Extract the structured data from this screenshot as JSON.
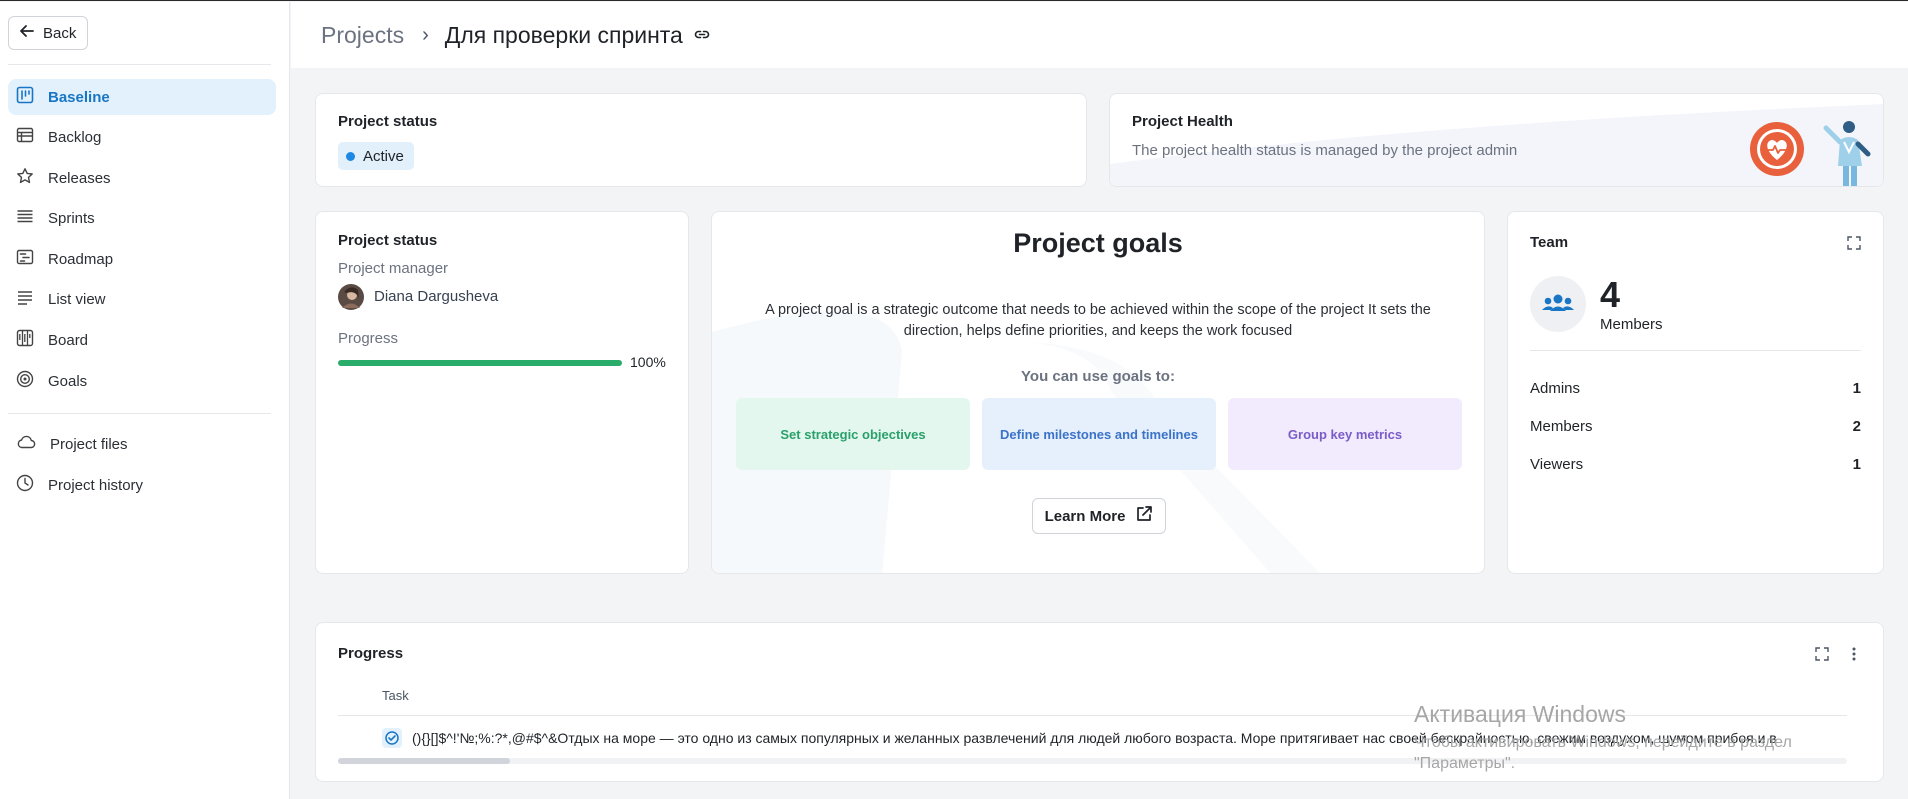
{
  "sidebar": {
    "back_label": "Back",
    "items": [
      {
        "label": "Baseline",
        "icon": "kanban-icon",
        "active": true
      },
      {
        "label": "Backlog",
        "icon": "table-icon"
      },
      {
        "label": "Releases",
        "icon": "star-icon"
      },
      {
        "label": "Sprints",
        "icon": "lines-icon"
      },
      {
        "label": "Roadmap",
        "icon": "roadmap-icon"
      },
      {
        "label": "List view",
        "icon": "list-icon"
      },
      {
        "label": "Board",
        "icon": "board-icon"
      },
      {
        "label": "Goals",
        "icon": "target-icon"
      }
    ],
    "secondary": [
      {
        "label": "Project files",
        "icon": "cloud-icon"
      },
      {
        "label": "Project history",
        "icon": "clock-icon"
      }
    ]
  },
  "header": {
    "projects": "Projects",
    "separator": "›",
    "project_name": "Для проверки спринта"
  },
  "status_card": {
    "title": "Project status",
    "status": "Active"
  },
  "health_card": {
    "title": "Project Health",
    "description": "The project health status is managed by the project admin"
  },
  "details_card": {
    "title": "Project status",
    "manager_label": "Project manager",
    "manager_name": "Diana Dargusheva",
    "progress_label": "Progress",
    "progress_text": "100%",
    "progress_value": 1.0
  },
  "goals_card": {
    "title": "Project goals",
    "description": "A project goal is a strategic outcome that needs to be achieved within the scope of the project It sets the direction, helps define priorities, and keeps the work focused",
    "use_label": "You can use goals to:",
    "boxes": [
      {
        "label": "Set strategic objectives"
      },
      {
        "label": "Define milestones and timelines"
      },
      {
        "label": "Group key metrics"
      }
    ],
    "learn_more": "Learn More"
  },
  "team_card": {
    "title": "Team",
    "count": "4",
    "count_label": "Members",
    "rows": [
      {
        "label": "Admins",
        "value": "1"
      },
      {
        "label": "Members",
        "value": "2"
      },
      {
        "label": "Viewers",
        "value": "1"
      }
    ]
  },
  "progress_card": {
    "title": "Progress",
    "column": "Task",
    "row_text": "(){}[]$^!'№;%:?*,@#$^&Отдых на море — это одно из самых популярных и желанных развлечений для людей любого возраста. Море притягивает нас своей бескрайностью, свежим воздухом, шумом прибоя и в"
  },
  "watermark": {
    "line1": "Активация Windows",
    "line2": "Чтобы активировать Windows, перейдите в раздел",
    "line3": "\"Параметры\"."
  },
  "colors": {
    "accent": "#1976c5",
    "active_bg": "#e3f1fc",
    "progress": "#2aad6b",
    "goal_green": "#e3f7ee",
    "goal_blue": "#e6effc",
    "goal_purple": "#f1ebfd"
  }
}
